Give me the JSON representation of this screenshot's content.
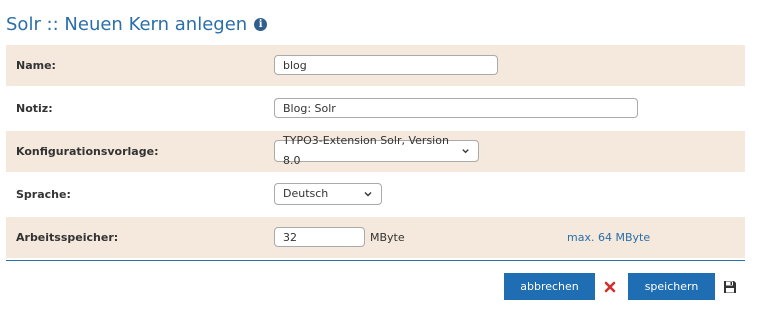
{
  "header": {
    "title": "Solr :: Neuen Kern anlegen",
    "info_icon": "info-icon"
  },
  "form": {
    "name": {
      "label": "Name:",
      "value": "blog"
    },
    "notiz": {
      "label": "Notiz:",
      "value": "Blog: Solr"
    },
    "konfiguration": {
      "label": "Konfigurationsvorlage:",
      "value": "TYPO3-Extension Solr, Version 8.0"
    },
    "sprache": {
      "label": "Sprache:",
      "value": "Deutsch"
    },
    "arbeitsspeicher": {
      "label": "Arbeitsspeicher:",
      "value": "32",
      "unit": "MByte",
      "hint": "max. 64 MByte"
    }
  },
  "actions": {
    "cancel_label": "abbrechen",
    "save_label": "speichern",
    "cancel_icon": "close-icon",
    "save_icon": "floppy-disk-icon"
  },
  "colors": {
    "accent": "#2a6fa8",
    "button": "#1f6db3",
    "row_alt": "#f5e8dc",
    "cancel_icon": "#d0312d"
  }
}
